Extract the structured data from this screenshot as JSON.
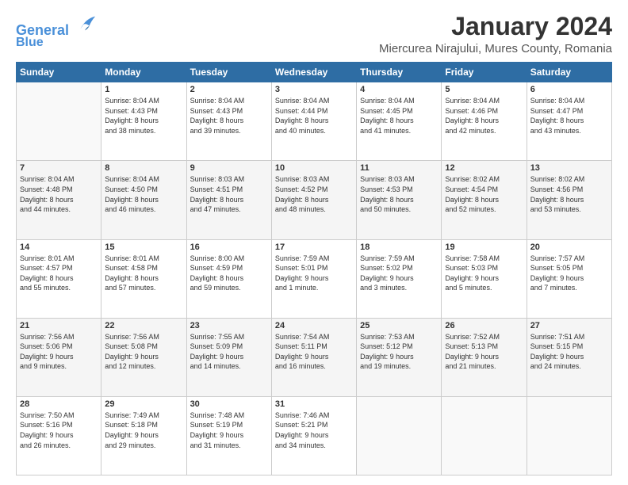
{
  "logo": {
    "line1": "General",
    "line2": "Blue"
  },
  "title": "January 2024",
  "subtitle": "Miercurea Nirajului, Mures County, Romania",
  "days_of_week": [
    "Sunday",
    "Monday",
    "Tuesday",
    "Wednesday",
    "Thursday",
    "Friday",
    "Saturday"
  ],
  "weeks": [
    [
      {
        "day": "",
        "info": ""
      },
      {
        "day": "1",
        "info": "Sunrise: 8:04 AM\nSunset: 4:43 PM\nDaylight: 8 hours\nand 38 minutes."
      },
      {
        "day": "2",
        "info": "Sunrise: 8:04 AM\nSunset: 4:43 PM\nDaylight: 8 hours\nand 39 minutes."
      },
      {
        "day": "3",
        "info": "Sunrise: 8:04 AM\nSunset: 4:44 PM\nDaylight: 8 hours\nand 40 minutes."
      },
      {
        "day": "4",
        "info": "Sunrise: 8:04 AM\nSunset: 4:45 PM\nDaylight: 8 hours\nand 41 minutes."
      },
      {
        "day": "5",
        "info": "Sunrise: 8:04 AM\nSunset: 4:46 PM\nDaylight: 8 hours\nand 42 minutes."
      },
      {
        "day": "6",
        "info": "Sunrise: 8:04 AM\nSunset: 4:47 PM\nDaylight: 8 hours\nand 43 minutes."
      }
    ],
    [
      {
        "day": "7",
        "info": "Sunrise: 8:04 AM\nSunset: 4:48 PM\nDaylight: 8 hours\nand 44 minutes."
      },
      {
        "day": "8",
        "info": "Sunrise: 8:04 AM\nSunset: 4:50 PM\nDaylight: 8 hours\nand 46 minutes."
      },
      {
        "day": "9",
        "info": "Sunrise: 8:03 AM\nSunset: 4:51 PM\nDaylight: 8 hours\nand 47 minutes."
      },
      {
        "day": "10",
        "info": "Sunrise: 8:03 AM\nSunset: 4:52 PM\nDaylight: 8 hours\nand 48 minutes."
      },
      {
        "day": "11",
        "info": "Sunrise: 8:03 AM\nSunset: 4:53 PM\nDaylight: 8 hours\nand 50 minutes."
      },
      {
        "day": "12",
        "info": "Sunrise: 8:02 AM\nSunset: 4:54 PM\nDaylight: 8 hours\nand 52 minutes."
      },
      {
        "day": "13",
        "info": "Sunrise: 8:02 AM\nSunset: 4:56 PM\nDaylight: 8 hours\nand 53 minutes."
      }
    ],
    [
      {
        "day": "14",
        "info": "Sunrise: 8:01 AM\nSunset: 4:57 PM\nDaylight: 8 hours\nand 55 minutes."
      },
      {
        "day": "15",
        "info": "Sunrise: 8:01 AM\nSunset: 4:58 PM\nDaylight: 8 hours\nand 57 minutes."
      },
      {
        "day": "16",
        "info": "Sunrise: 8:00 AM\nSunset: 4:59 PM\nDaylight: 8 hours\nand 59 minutes."
      },
      {
        "day": "17",
        "info": "Sunrise: 7:59 AM\nSunset: 5:01 PM\nDaylight: 9 hours\nand 1 minute."
      },
      {
        "day": "18",
        "info": "Sunrise: 7:59 AM\nSunset: 5:02 PM\nDaylight: 9 hours\nand 3 minutes."
      },
      {
        "day": "19",
        "info": "Sunrise: 7:58 AM\nSunset: 5:03 PM\nDaylight: 9 hours\nand 5 minutes."
      },
      {
        "day": "20",
        "info": "Sunrise: 7:57 AM\nSunset: 5:05 PM\nDaylight: 9 hours\nand 7 minutes."
      }
    ],
    [
      {
        "day": "21",
        "info": "Sunrise: 7:56 AM\nSunset: 5:06 PM\nDaylight: 9 hours\nand 9 minutes."
      },
      {
        "day": "22",
        "info": "Sunrise: 7:56 AM\nSunset: 5:08 PM\nDaylight: 9 hours\nand 12 minutes."
      },
      {
        "day": "23",
        "info": "Sunrise: 7:55 AM\nSunset: 5:09 PM\nDaylight: 9 hours\nand 14 minutes."
      },
      {
        "day": "24",
        "info": "Sunrise: 7:54 AM\nSunset: 5:11 PM\nDaylight: 9 hours\nand 16 minutes."
      },
      {
        "day": "25",
        "info": "Sunrise: 7:53 AM\nSunset: 5:12 PM\nDaylight: 9 hours\nand 19 minutes."
      },
      {
        "day": "26",
        "info": "Sunrise: 7:52 AM\nSunset: 5:13 PM\nDaylight: 9 hours\nand 21 minutes."
      },
      {
        "day": "27",
        "info": "Sunrise: 7:51 AM\nSunset: 5:15 PM\nDaylight: 9 hours\nand 24 minutes."
      }
    ],
    [
      {
        "day": "28",
        "info": "Sunrise: 7:50 AM\nSunset: 5:16 PM\nDaylight: 9 hours\nand 26 minutes."
      },
      {
        "day": "29",
        "info": "Sunrise: 7:49 AM\nSunset: 5:18 PM\nDaylight: 9 hours\nand 29 minutes."
      },
      {
        "day": "30",
        "info": "Sunrise: 7:48 AM\nSunset: 5:19 PM\nDaylight: 9 hours\nand 31 minutes."
      },
      {
        "day": "31",
        "info": "Sunrise: 7:46 AM\nSunset: 5:21 PM\nDaylight: 9 hours\nand 34 minutes."
      },
      {
        "day": "",
        "info": ""
      },
      {
        "day": "",
        "info": ""
      },
      {
        "day": "",
        "info": ""
      }
    ]
  ]
}
